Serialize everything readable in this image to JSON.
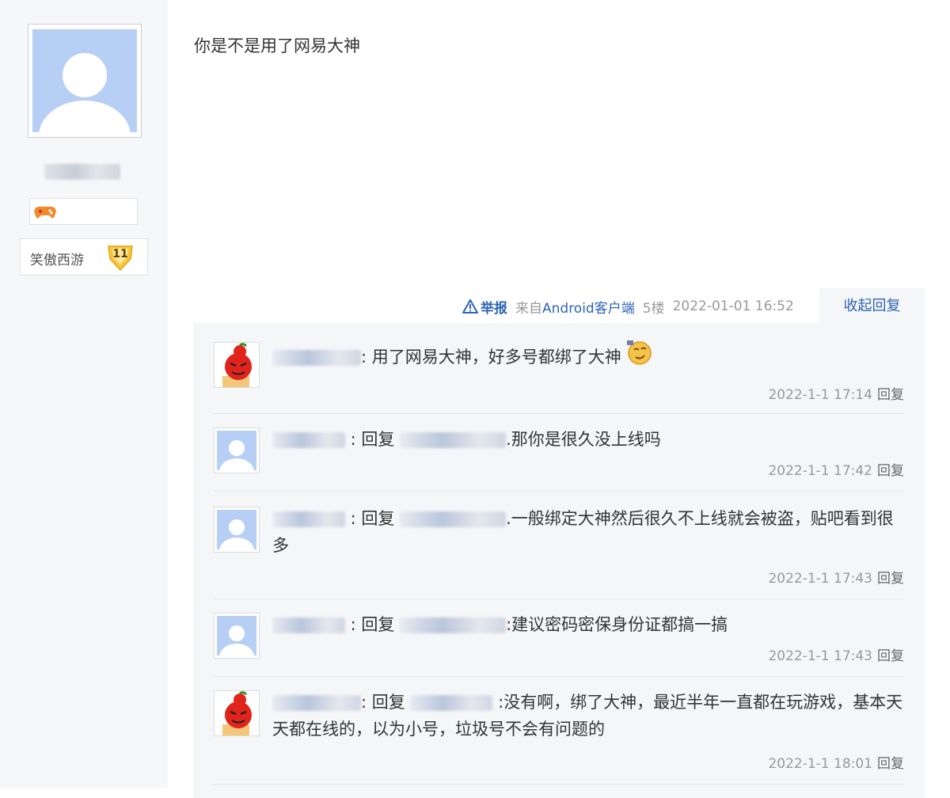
{
  "author": {
    "game_name": "笑傲西游",
    "game_level": "11"
  },
  "post": {
    "content": "你是不是用了网易大神",
    "report_label": "举报",
    "source_prefix": "来自",
    "source_client": "Android客户端",
    "floor": "5楼",
    "datetime": "2022-01-01 16:52",
    "toggle_replies_label": "收起回复"
  },
  "replies": [
    {
      "prefix": "",
      "body": ": 用了网易大神，好多号都绑了大神",
      "time": "2022-1-1 17:14",
      "reply_label": "回复"
    },
    {
      "prefix": " : 回复 ",
      "body": ".那你是很久没上线吗",
      "time": "2022-1-1 17:42",
      "reply_label": "回复"
    },
    {
      "prefix": " : 回复 ",
      "body": ".一般绑定大神然后很久不上线就会被盗，贴吧看到很多",
      "time": "2022-1-1 17:43",
      "reply_label": "回复"
    },
    {
      "prefix": " : 回复 ",
      "body": ":建议密码密保身份证都搞一搞",
      "time": "2022-1-1 17:43",
      "reply_label": "回复"
    },
    {
      "prefix": ": 回复 ",
      "body": " :没有啊，绑了大神，最近半年一直都在玩游戏，基本天天都在线的，以为小号，垃圾号不会有问题的",
      "time": "2022-1-1 18:01",
      "reply_label": "回复"
    }
  ],
  "colors": {
    "link": "#2d64b3",
    "meta": "#999999",
    "avatar_bg": "#b8cff5"
  }
}
